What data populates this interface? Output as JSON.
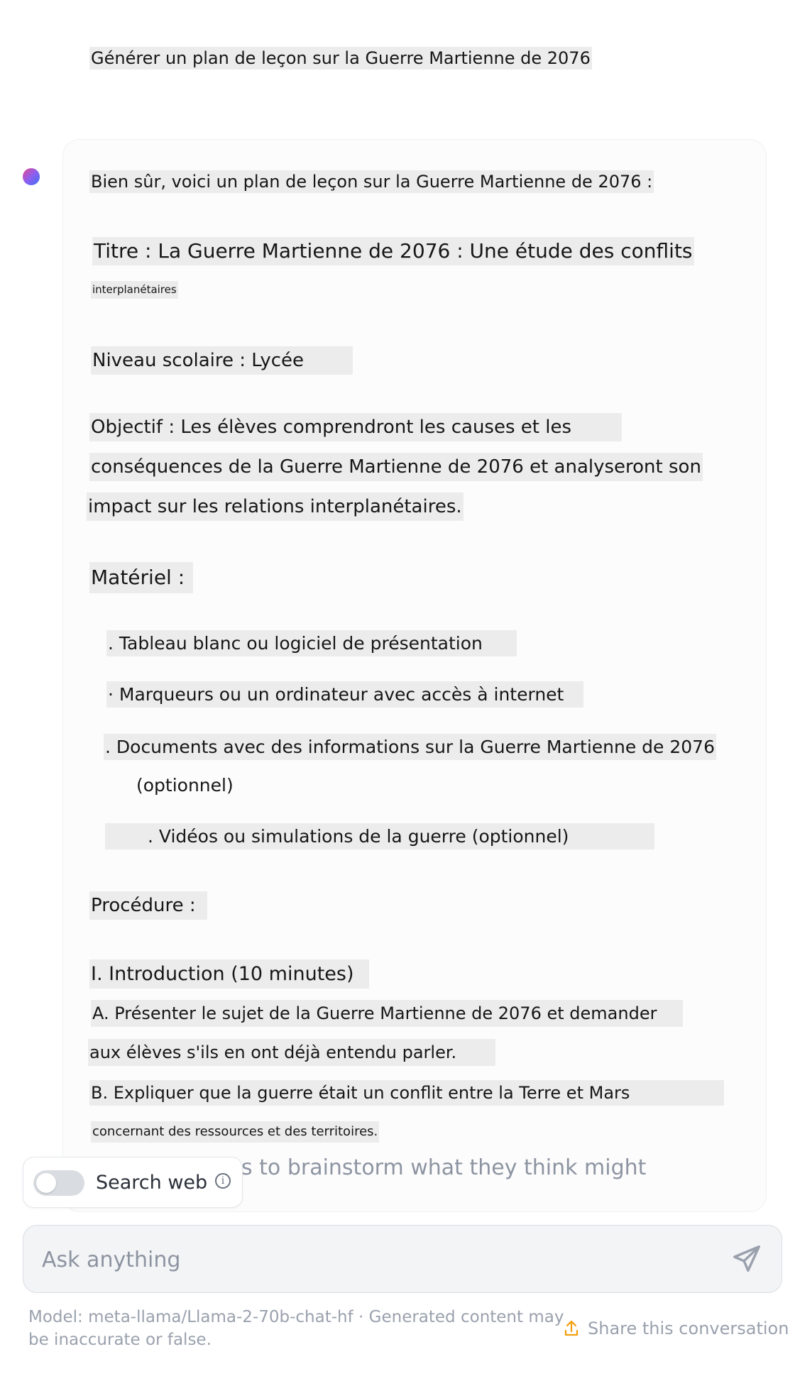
{
  "user_message": "Générer un plan de leçon sur la Guerre Martienne de 2076",
  "assistant": {
    "intro": "Bien sûr, voici un plan de leçon sur la Guerre Martienne de 2076 :",
    "title_line": "Titre : La Guerre Martienne de 2076 : Une étude des conflits",
    "title_cont": "interplanétaires",
    "level": "Niveau scolaire : Lycée",
    "objective": [
      "Objectif : Les élèves comprendront les causes et les",
      "conséquences de la Guerre Martienne de 2076 et analyseront son",
      "impact sur les relations interplanétaires."
    ],
    "materials_heading": "Matériel :",
    "materials": [
      ". Tableau blanc ou logiciel de présentation",
      "· Marqueurs ou un ordinateur avec accès à internet",
      ". Documents avec des informations sur la Guerre Martienne de 2076",
      "(optionnel)",
      ". Vidéos ou simulations de la guerre (optionnel)"
    ],
    "procedure_heading": "Procédure :",
    "section_1": "I. Introduction (10 minutes)",
    "section_1_lines": [
      "A. Présenter le sujet de la Guerre Martienne de 2076 et demander",
      "aux élèves s'ils en ont déjà entendu parler.",
      "B. Expliquer que la guerre était un conflit entre la Terre et Mars",
      "concernant des ressources et des territoires."
    ],
    "faded_line": "s to brainstorm what they think might"
  },
  "search_toggle": {
    "label": "Search web",
    "enabled": false
  },
  "input": {
    "placeholder": "Ask anything"
  },
  "footer": {
    "disclaimer": "Model: meta-llama/Llama-2-70b-chat-hf · Generated content may be inaccurate or false.",
    "share_label": "Share this conversation"
  },
  "icons": {
    "avatar": "assistant-avatar",
    "info": "info-icon",
    "send": "send-icon",
    "share": "share-icon"
  },
  "colors": {
    "accent": "#f59e0b",
    "muted_text": "#9aa1ad",
    "highlight": "#ececec"
  }
}
